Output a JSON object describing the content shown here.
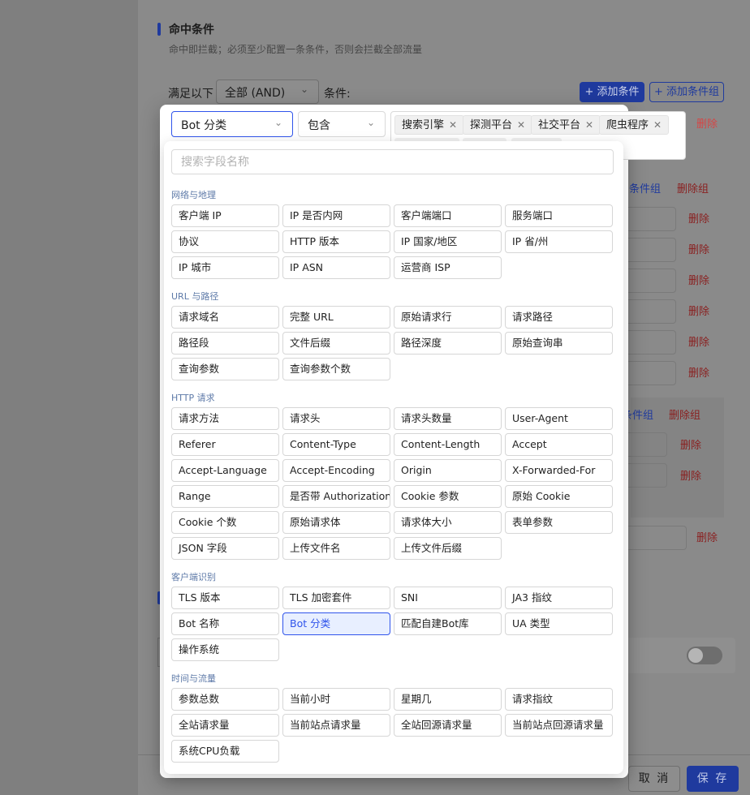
{
  "section": {
    "title": "命中条件",
    "description": "命中即拦截；必须至少配置一条条件，否则会拦截全部流量"
  },
  "match": {
    "label": "满足以下",
    "mode": "全部 (AND)",
    "conditions_label": "条件:",
    "add_condition": "+ 添加条件",
    "add_group": "+ 添加条件组"
  },
  "background": {
    "delete": "删除",
    "delete_group": "删除组",
    "add_group_partial_1": "加条件组",
    "add_group_partial_2": "条件组"
  },
  "condition_row": {
    "field": "Bot 分类",
    "operator": "包含",
    "values": [
      "搜索引擎",
      "探测平台",
      "社交平台",
      "爬虫程序"
    ],
    "delete": "删除"
  },
  "dropdown": {
    "search_placeholder": "搜索字段名称",
    "selected": "Bot 分类",
    "groups": [
      {
        "title": "网络与地理",
        "items": [
          "客户端 IP",
          "IP 是否内网",
          "客户端端口",
          "服务端口",
          "协议",
          "HTTP 版本",
          "IP 国家/地区",
          "IP 省/州",
          "IP 城市",
          "IP ASN",
          "运营商 ISP"
        ]
      },
      {
        "title": "URL 与路径",
        "items": [
          "请求域名",
          "完整 URL",
          "原始请求行",
          "请求路径",
          "路径段",
          "文件后缀",
          "路径深度",
          "原始查询串",
          "查询参数",
          "查询参数个数"
        ]
      },
      {
        "title": "HTTP 请求",
        "items": [
          "请求方法",
          "请求头",
          "请求头数量",
          "User-Agent",
          "Referer",
          "Content-Type",
          "Content-Length",
          "Accept",
          "Accept-Language",
          "Accept-Encoding",
          "Origin",
          "X-Forwarded-For",
          "Range",
          "是否带 Authorization",
          "Cookie 参数",
          "原始 Cookie",
          "Cookie 个数",
          "原始请求体",
          "请求体大小",
          "表单参数",
          "JSON 字段",
          "上传文件名",
          "上传文件后缀"
        ]
      },
      {
        "title": "客户端识别",
        "items": [
          "TLS 版本",
          "TLS 加密套件",
          "SNI",
          "JA3 指纹",
          "Bot 名称",
          "Bot 分类",
          "匹配自建Bot库",
          "UA 类型",
          "操作系统"
        ]
      },
      {
        "title": "时间与流量",
        "items": [
          "参数总数",
          "当前小时",
          "星期几",
          "请求指纹",
          "全站请求量",
          "当前站点请求量",
          "全站回源请求量",
          "当前站点回源请求量",
          "系统CPU负载"
        ]
      }
    ]
  },
  "footer": {
    "cancel": "取 消",
    "save": "保 存"
  },
  "colors": {
    "primary": "#2f54eb",
    "danger": "#d64545",
    "group_title": "#5e7aa8"
  }
}
